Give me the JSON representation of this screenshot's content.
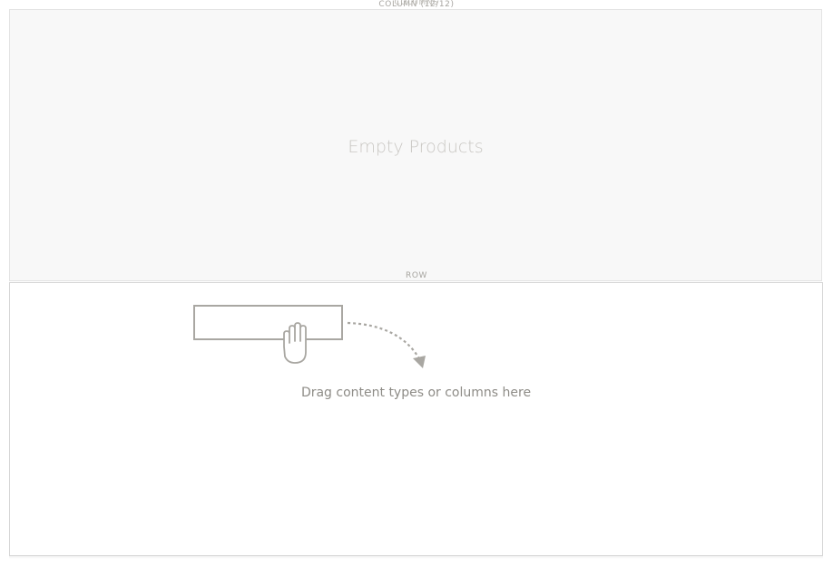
{
  "column": {
    "label": "COLUMN (12/12)",
    "label_overlap": "COLUMNS",
    "empty_text": "Empty Products"
  },
  "row": {
    "label": "ROW"
  },
  "drop_zone": {
    "hint": "Drag content types or columns here",
    "icon": "drag-hand-icon"
  },
  "colors": {
    "column_bg": "#f8f8f8",
    "border": "#d6d6d6",
    "label": "#a7a5a0",
    "illustration": "#a9a7a2"
  }
}
